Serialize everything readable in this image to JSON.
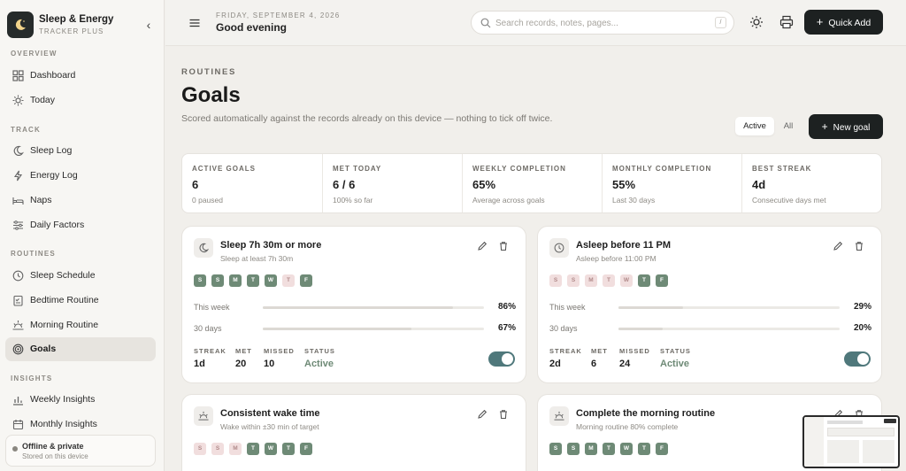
{
  "brand": {
    "title": "Sleep & Energy",
    "subtitle": "TRACKER PLUS"
  },
  "sidebar": {
    "sections": [
      {
        "label": "OVERVIEW",
        "items": [
          {
            "label": "Dashboard",
            "icon": "grid-icon"
          },
          {
            "label": "Today",
            "icon": "sun-icon"
          }
        ]
      },
      {
        "label": "TRACK",
        "items": [
          {
            "label": "Sleep Log",
            "icon": "moon-icon"
          },
          {
            "label": "Energy Log",
            "icon": "bolt-icon"
          },
          {
            "label": "Naps",
            "icon": "bed-icon"
          },
          {
            "label": "Daily Factors",
            "icon": "sliders-icon"
          }
        ]
      },
      {
        "label": "ROUTINES",
        "items": [
          {
            "label": "Sleep Schedule",
            "icon": "clock-icon"
          },
          {
            "label": "Bedtime Routine",
            "icon": "checklist-icon"
          },
          {
            "label": "Morning Routine",
            "icon": "sunrise-icon"
          },
          {
            "label": "Goals",
            "icon": "target-icon",
            "active": true
          }
        ]
      },
      {
        "label": "INSIGHTS",
        "items": [
          {
            "label": "Weekly Insights",
            "icon": "chart-icon"
          },
          {
            "label": "Monthly Insights",
            "icon": "calendar-icon"
          }
        ]
      }
    ],
    "offline": {
      "title": "Offline & private",
      "subtitle": "Stored on this device"
    }
  },
  "topbar": {
    "date": "FRIDAY, SEPTEMBER 4, 2026",
    "greeting": "Good evening",
    "search_placeholder": "Search records, notes, pages...",
    "search_shortcut": "/",
    "quick_add": "Quick Add"
  },
  "page": {
    "kicker": "ROUTINES",
    "title": "Goals",
    "description": "Scored automatically against the records already on this device — nothing to tick off twice.",
    "filter_active": "Active",
    "filter_all": "All",
    "new_goal": "New goal"
  },
  "stats": [
    {
      "label": "ACTIVE GOALS",
      "value": "6",
      "sub": "0 paused"
    },
    {
      "label": "MET TODAY",
      "value": "6 / 6",
      "sub": "100% so far"
    },
    {
      "label": "WEEKLY COMPLETION",
      "value": "65%",
      "sub": "Average across goals"
    },
    {
      "label": "MONTHLY COMPLETION",
      "value": "55%",
      "sub": "Last 30 days"
    },
    {
      "label": "BEST STREAK",
      "value": "4d",
      "sub": "Consecutive days met"
    }
  ],
  "labels": {
    "this_week": "This week",
    "thirty_days": "30 days",
    "streak": "STREAK",
    "met": "MET",
    "missed": "MISSED",
    "status": "STATUS"
  },
  "goals": [
    {
      "title": "Sleep 7h 30m or more",
      "subtitle": "Sleep at least 7h 30m",
      "icon": "moon-icon",
      "days": [
        {
          "d": "S",
          "met": true
        },
        {
          "d": "S",
          "met": true
        },
        {
          "d": "M",
          "met": true
        },
        {
          "d": "T",
          "met": true
        },
        {
          "d": "W",
          "met": true
        },
        {
          "d": "T",
          "met": false
        },
        {
          "d": "F",
          "met": true
        }
      ],
      "week_pct": "86%",
      "week_value": 86,
      "month_pct": "67%",
      "month_value": 67,
      "streak": "1d",
      "met": "20",
      "missed": "10",
      "status": "Active",
      "enabled": true
    },
    {
      "title": "Asleep before 11 PM",
      "subtitle": "Asleep before 11:00 PM",
      "icon": "clock-icon",
      "days": [
        {
          "d": "S",
          "met": false
        },
        {
          "d": "S",
          "met": false
        },
        {
          "d": "M",
          "met": false
        },
        {
          "d": "T",
          "met": false
        },
        {
          "d": "W",
          "met": false
        },
        {
          "d": "T",
          "met": true
        },
        {
          "d": "F",
          "met": true
        }
      ],
      "week_pct": "29%",
      "week_value": 29,
      "month_pct": "20%",
      "month_value": 20,
      "streak": "2d",
      "met": "6",
      "missed": "24",
      "status": "Active",
      "enabled": true
    },
    {
      "title": "Consistent wake time",
      "subtitle": "Wake within ±30 min of target",
      "icon": "sunrise-icon",
      "days": [
        {
          "d": "S",
          "met": false
        },
        {
          "d": "S",
          "met": false
        },
        {
          "d": "M",
          "met": false
        },
        {
          "d": "T",
          "met": true
        },
        {
          "d": "W",
          "met": true
        },
        {
          "d": "T",
          "met": true
        },
        {
          "d": "F",
          "met": true
        }
      ]
    },
    {
      "title": "Complete the morning routine",
      "subtitle": "Morning routine 80% complete",
      "icon": "sunrise-icon",
      "days": [
        {
          "d": "S",
          "met": true
        },
        {
          "d": "S",
          "met": true
        },
        {
          "d": "M",
          "met": true
        },
        {
          "d": "T",
          "met": true
        },
        {
          "d": "W",
          "met": true
        },
        {
          "d": "T",
          "met": true
        },
        {
          "d": "F",
          "met": true
        }
      ]
    }
  ]
}
